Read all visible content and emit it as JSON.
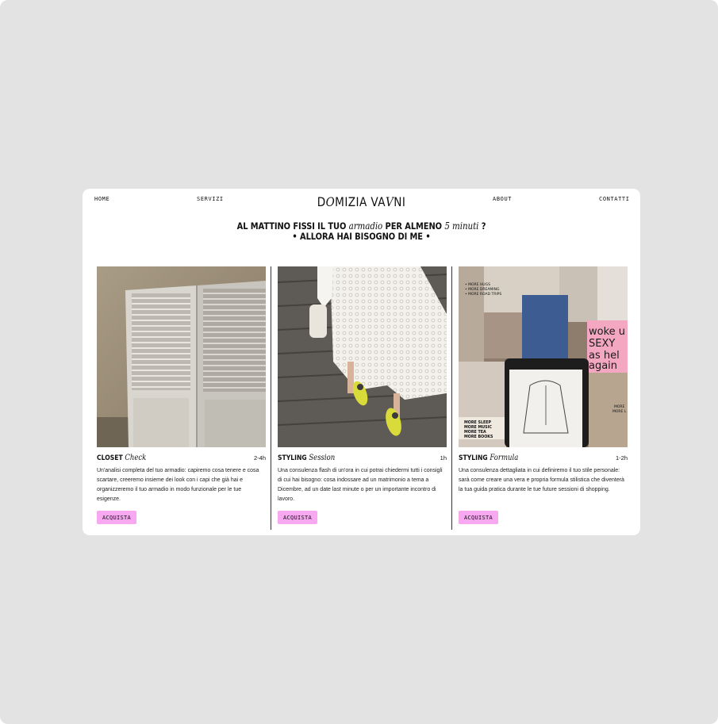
{
  "nav": {
    "home": "HOME",
    "services": "SERVIZI",
    "about": "ABOUT",
    "contacts": "CONTATTI"
  },
  "logo": {
    "part1": "D",
    "part2": "O",
    "part3": "MIZIA VA",
    "part4": "V",
    "part5": "NI"
  },
  "headline": {
    "a": "AL MATTINO FISSI IL TUO ",
    "b": "armadio",
    "c": " PER ALMENO ",
    "d": "5 minuti",
    "e": " ?",
    "line2": "• ALLORA HAI BISOGNO DI ME •"
  },
  "cards": [
    {
      "title_bold": "CLOSET ",
      "title_script": "Check",
      "duration": "2-4h",
      "description": "Un'analisi completa del tuo armadio: capiremo cosa tenere e cosa scartare, creeremo insieme dei look con i capi che già hai e organizzeremo il tuo armadio in modo funzionale per le tue esigenze.",
      "button": "ACQUISTA"
    },
    {
      "title_bold": "STYLING ",
      "title_script": "Session",
      "duration": "1h",
      "description": "Una consulenza flash di un'ora in cui potrai chiedermi tutti i consigli di cui hai bisogno: cosa indossare ad un matrimonio a tema a Dicembre, ad un date last minute o per un importante incontro di lavoro.",
      "button": "ACQUISTA"
    },
    {
      "title_bold": "STYLING ",
      "title_script": "Formula",
      "duration": "1-2h",
      "description": "Una consulenza dettagliata in cui definiremo il tuo stile personale: sarà come creare una vera e propria formula stilistica che diventerà la tua guida pratica durante le tue future sessioni di shopping.",
      "button": "ACQUISTA"
    }
  ],
  "collage_text": {
    "more1": "• MORE HUGS",
    "more2": "• MORE DREAMING",
    "more3": "• MORE ROAD TRIPS",
    "poster1": "woke u",
    "poster2": "SEXY",
    "poster3": "as hel",
    "poster4": "again",
    "list1": "MORE SLEEP",
    "list2": "MORE MUSIC",
    "list3": "MORE TEA",
    "list4": "MORE BOOKS",
    "side1": "MORE",
    "side2": "MORE L"
  },
  "colors": {
    "background": "#e3e3e3",
    "card": "#ffffff",
    "button": "#f7a8f1"
  }
}
